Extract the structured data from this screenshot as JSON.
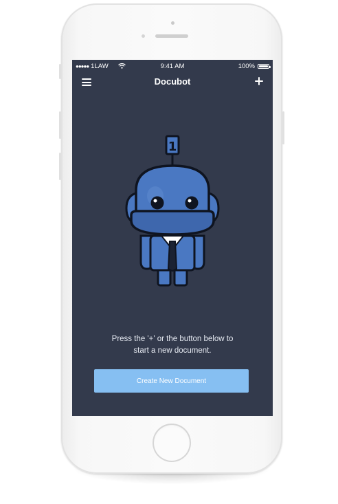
{
  "status_bar": {
    "carrier_dots": "●●●●●",
    "carrier": "1LAW",
    "time": "9:41 AM",
    "battery": "100%",
    "battery_level": 1.0
  },
  "nav": {
    "title": "Docubot",
    "left_icon": "hamburger-menu-icon",
    "right_icon": "plus-icon"
  },
  "mascot": {
    "antenna_label": "1",
    "description_icon": "robot-mascot"
  },
  "main": {
    "instructions_line1": "Press the '+' or the button below to",
    "instructions_line2": "start a new document.",
    "create_button_label": "Create New Document"
  },
  "colors": {
    "screen_background": "#333a4c",
    "button_background": "#86bff2",
    "robot_blue": "#4a78c2",
    "outline": "#0f1420"
  }
}
